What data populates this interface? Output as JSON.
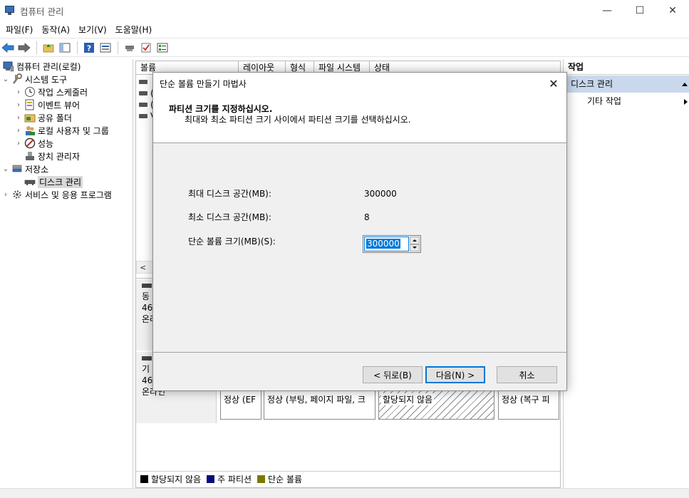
{
  "window": {
    "title": "컴퓨터 관리",
    "minimize": "—",
    "maximize": "☐",
    "close": "✕"
  },
  "menu": [
    "파일(F)",
    "동작(A)",
    "보기(V)",
    "도움말(H)"
  ],
  "tree": {
    "root": "컴퓨터 관리(로컬)",
    "system_tools": "시스템 도구",
    "task_scheduler": "작업 스케줄러",
    "event_viewer": "이벤트 뷰어",
    "shared_folders": "공유 폴더",
    "local_users": "로컬 사용자 및 그룹",
    "performance": "성능",
    "device_manager": "장치 관리자",
    "storage": "저장소",
    "disk_management": "디스크 관리",
    "services": "서비스 및 응용 프로그램"
  },
  "volume_columns": [
    "볼륨",
    "레이아웃",
    "형식",
    "파일 시스템",
    "상태"
  ],
  "volume_rows": [
    "(",
    "(",
    "(",
    "V"
  ],
  "disks": [
    {
      "line1": "동",
      "line2": "46",
      "line3": "온라"
    },
    {
      "line1": "기",
      "line2": "46",
      "line3": "온라인"
    }
  ],
  "partitions": [
    {
      "text": "정상 (EF"
    },
    {
      "text": "정상 (부팅, 페이지 파일, 크"
    },
    {
      "text": "할당되지 않음"
    },
    {
      "text": "정상 (복구 피"
    }
  ],
  "legend": [
    {
      "label": "할당되지 않음",
      "color": "#000000"
    },
    {
      "label": "주 파티션",
      "color": "#0a0a7a"
    },
    {
      "label": "단순 볼륨",
      "color": "#7a7a00"
    }
  ],
  "actions": {
    "header": "작업",
    "section": "디스크 관리",
    "item": "기타 작업"
  },
  "dialog": {
    "title": "단순 볼륨 만들기 마법사",
    "heading": "파티션 크기를 지정하십시오.",
    "subheading": "최대와 최소 파티션 크기 사이에서 파티션 크기를 선택하십시오.",
    "max_label": "최대 디스크 공간(MB):",
    "max_value": "300000",
    "min_label": "최소 디스크 공간(MB):",
    "min_value": "8",
    "size_label": "단순 볼륨 크기(MB)(S):",
    "size_value": "300000",
    "back_button": "< 뒤로(B)",
    "next_button": "다음(N) >",
    "cancel_button": "취소"
  }
}
